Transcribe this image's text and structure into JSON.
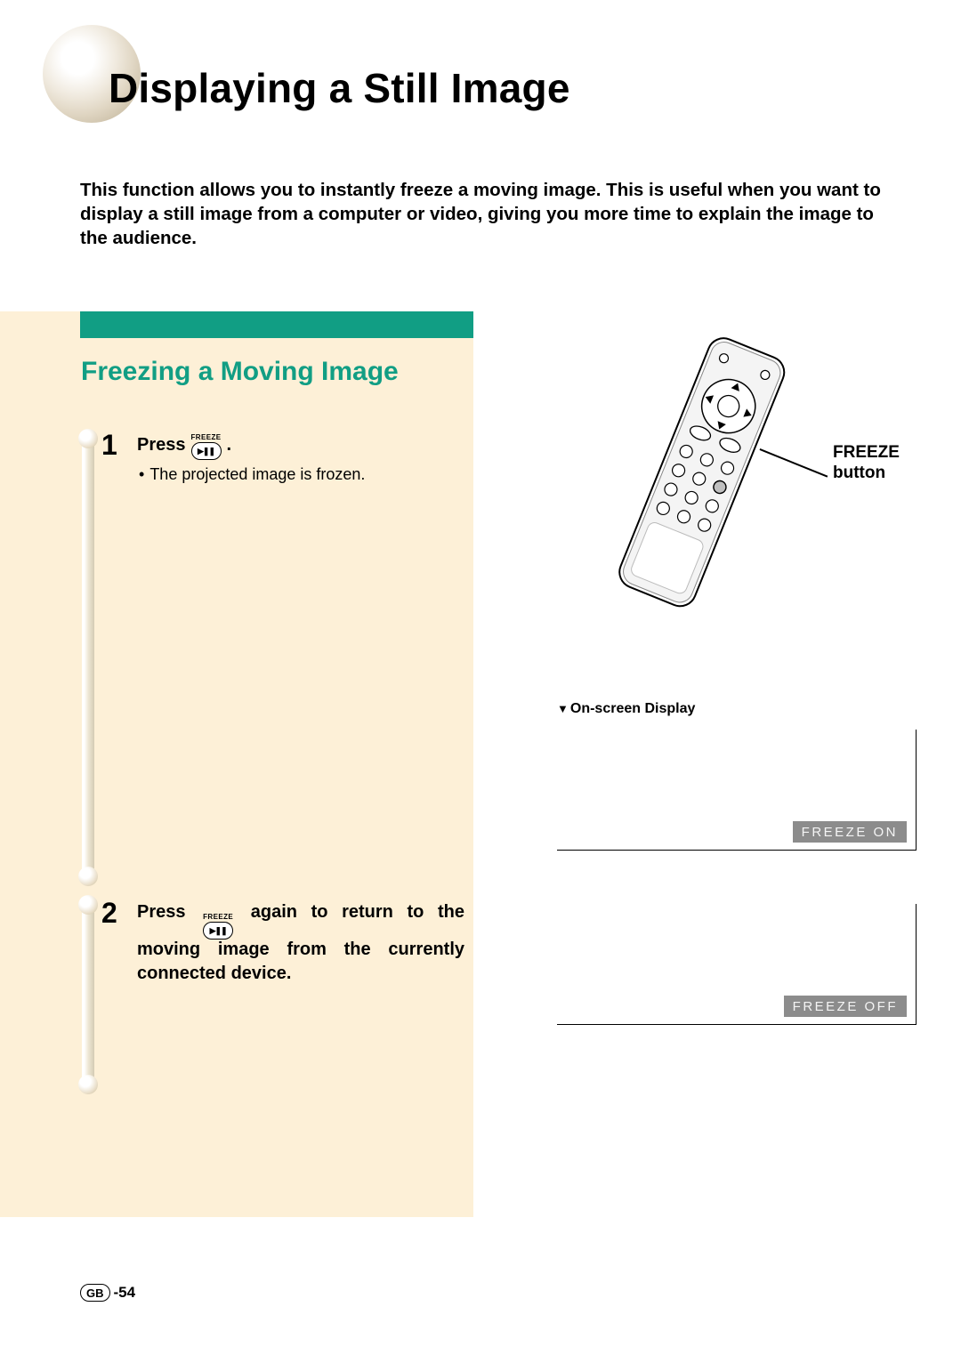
{
  "title": "Displaying a Still Image",
  "intro": "This function allows you to instantly freeze a moving image. This is useful when you want to display a still image from a computer or video, giving you more time to explain the image to the audience.",
  "section_heading": "Freezing a Moving Image",
  "steps": {
    "s1": {
      "num": "1",
      "press": "Press",
      "btn_tiny": "FREEZE",
      "period": ".",
      "sub": "The projected image is frozen."
    },
    "s2": {
      "num": "2",
      "press": "Press",
      "btn_tiny": "FREEZE",
      "rest": "again to return to the moving image from the currently connected device."
    }
  },
  "callout": {
    "freeze_label_l1": "FREEZE",
    "freeze_label_l2": "button"
  },
  "osd": {
    "heading": "On-screen Display",
    "on": "FREEZE ON",
    "off": "FREEZE OFF"
  },
  "footer": {
    "region": "GB",
    "page": "-54"
  }
}
